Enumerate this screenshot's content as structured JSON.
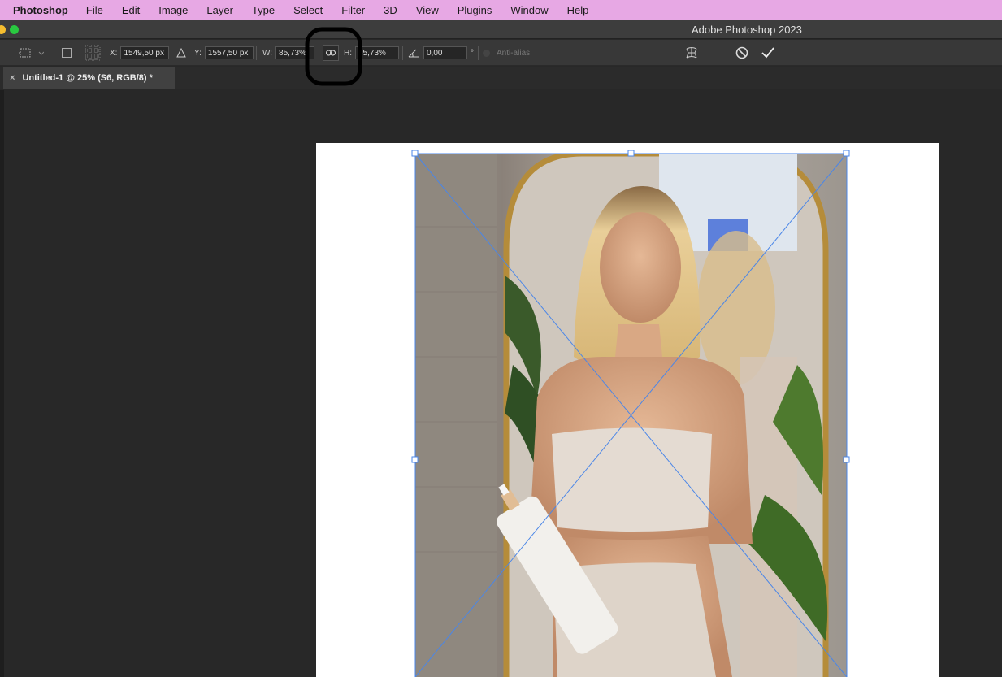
{
  "menubar": {
    "app": "Photoshop",
    "items": [
      "File",
      "Edit",
      "Image",
      "Layer",
      "Type",
      "Select",
      "Filter",
      "3D",
      "View",
      "Plugins",
      "Window",
      "Help"
    ]
  },
  "titlebar": {
    "title": "Adobe Photoshop 2023"
  },
  "options": {
    "x_label": "X:",
    "x_value": "1549,50 px",
    "y_label": "Y:",
    "y_value": "1557,50 px",
    "w_label": "W:",
    "w_value": "85,73%",
    "h_label": "H:",
    "h_value": "85,73%",
    "angle_value": "0,00",
    "angle_unit": "°",
    "antialias_label": "Anti-alias"
  },
  "document": {
    "tab_title": "Untitled-1 @ 25% (S6, RGB/8) *",
    "close": "×"
  },
  "colors": {
    "menubar": "#e7a8e4",
    "transform_handles": "#4a86e8",
    "annotation": "#000000"
  }
}
